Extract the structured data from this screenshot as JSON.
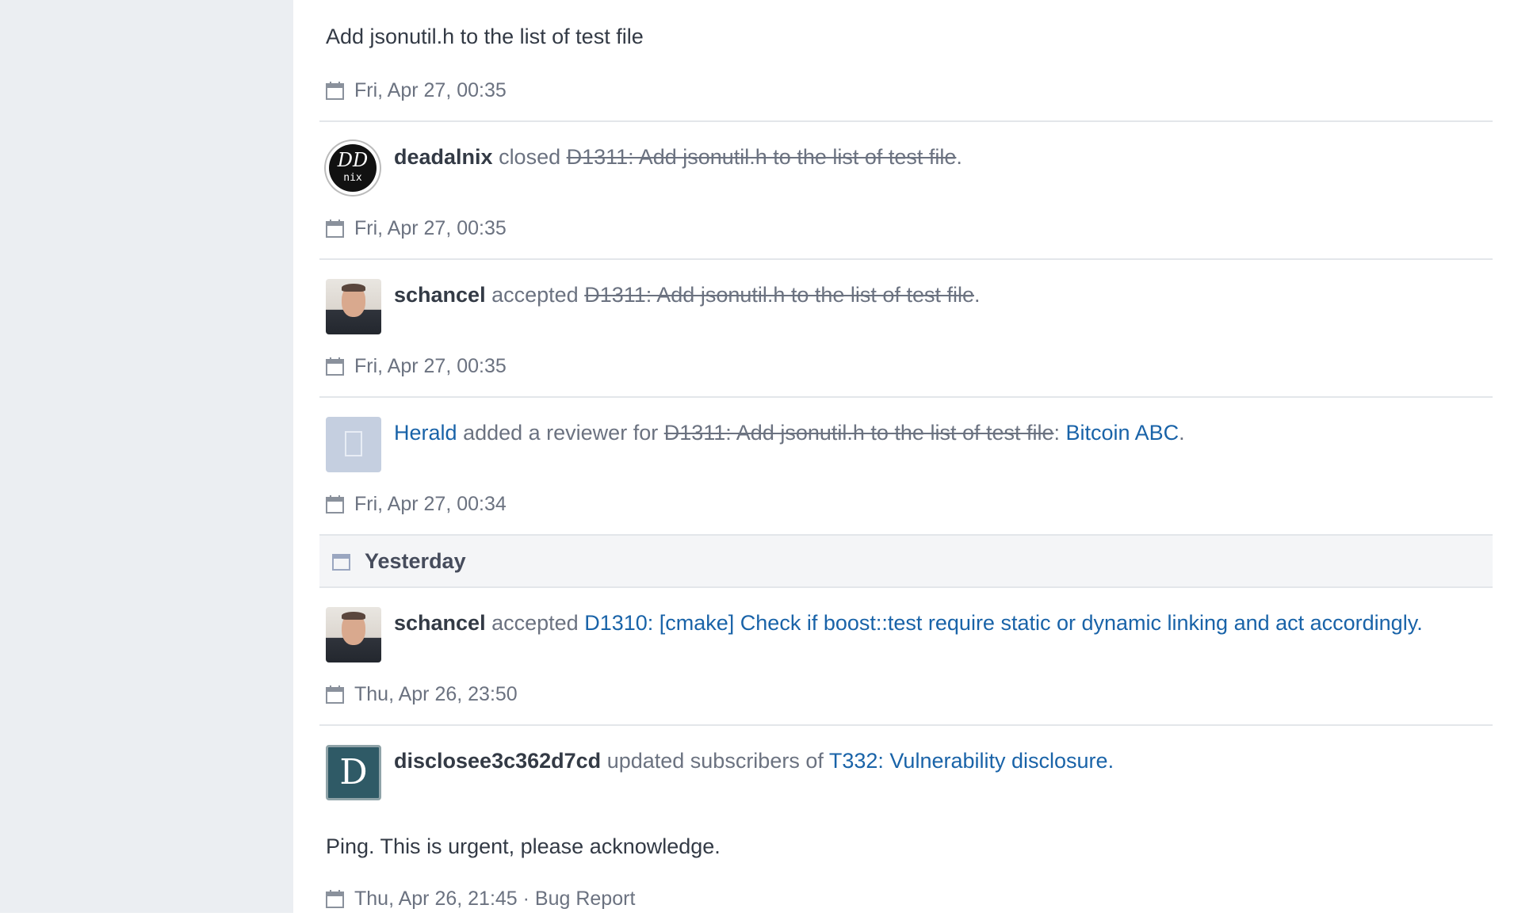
{
  "feed": {
    "story0": {
      "body": "Add jsonutil.h to the list of test file",
      "date": "Fri, Apr 27, 00:35"
    },
    "story1": {
      "actor": "deadalnix",
      "verb": "closed",
      "object": "D1311: Add jsonutil.h to the list of test file",
      "end": ".",
      "date": "Fri, Apr 27, 00:35",
      "avatar_line1": "DD",
      "avatar_line2": "nix"
    },
    "story2": {
      "actor": "schancel",
      "verb": "accepted",
      "object": "D1311: Add jsonutil.h to the list of test file",
      "end": ".",
      "date": "Fri, Apr 27, 00:35"
    },
    "story3": {
      "actor": "Herald",
      "verb": "added a reviewer for",
      "object": "D1311: Add jsonutil.h to the list of test file",
      "sep": ": ",
      "reviewer": "Bitcoin ABC",
      "end": ".",
      "date": "Fri, Apr 27, 00:34"
    },
    "day_header": "Yesterday",
    "story4": {
      "actor": "schancel",
      "verb": "accepted",
      "object": "D1310: [cmake] Check if boost::test require static or dynamic linking and act accordingly",
      "end": ".",
      "date": "Thu, Apr 26, 23:50"
    },
    "story5": {
      "actor": "disclosee3c362d7cd",
      "verb": "updated subscribers of",
      "object": "T332: Vulnerability disclosure",
      "end": ".",
      "avatar_letter": "D",
      "body": "Ping. This is urgent, please acknowledge.",
      "date": "Thu, Apr 26, 21:45",
      "date_sep": " · ",
      "type": "Bug Report"
    }
  },
  "colors": {
    "link": "#1963a8",
    "rail": "#ebeef2",
    "divider": "#e3e6ea",
    "disclosee_avatar": "#2f5a66"
  },
  "icons": {
    "calendar": "calendar-icon"
  }
}
